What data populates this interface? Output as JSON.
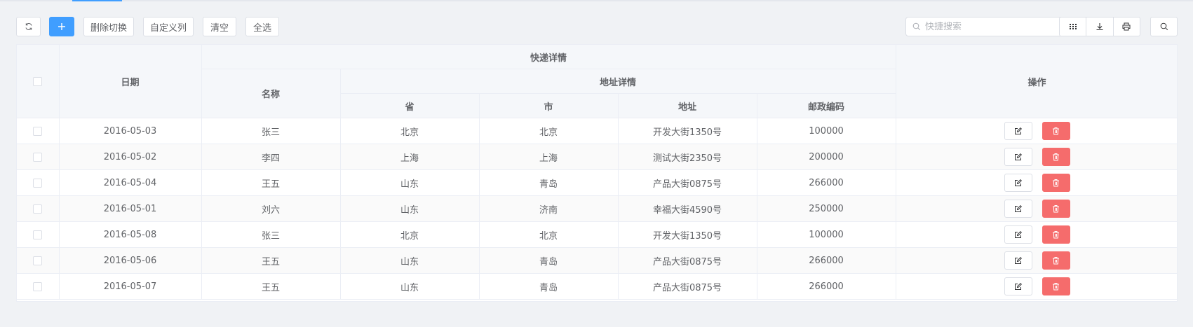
{
  "theme": {
    "accent": "#409eff",
    "danger": "#f56c6c",
    "border": "#dcdfe6"
  },
  "toolbar": {
    "refresh_icon": "refresh-icon",
    "add_icon": "plus-icon",
    "delete_toggle_label": "删除切换",
    "custom_column_label": "自定义列",
    "clear_label": "清空",
    "select_all_label": "全选",
    "search_placeholder": "快捷搜索",
    "columns_icon": "grid-icon",
    "export_icon": "download-icon",
    "print_icon": "printer-icon",
    "search_button_icon": "search-icon"
  },
  "table": {
    "headers": {
      "date": "日期",
      "express_details": "快递详情",
      "name": "名称",
      "address_details": "地址详情",
      "province": "省",
      "city": "市",
      "address": "地址",
      "postcode": "邮政编码",
      "actions": "操作"
    },
    "rows": [
      {
        "date": "2016-05-03",
        "name": "张三",
        "province": "北京",
        "city": "北京",
        "address": "开发大街1350号",
        "postcode": "100000"
      },
      {
        "date": "2016-05-02",
        "name": "李四",
        "province": "上海",
        "city": "上海",
        "address": "测试大街2350号",
        "postcode": "200000"
      },
      {
        "date": "2016-05-04",
        "name": "王五",
        "province": "山东",
        "city": "青岛",
        "address": "产品大街0875号",
        "postcode": "266000"
      },
      {
        "date": "2016-05-01",
        "name": "刘六",
        "province": "山东",
        "city": "济南",
        "address": "幸福大街4590号",
        "postcode": "250000"
      },
      {
        "date": "2016-05-08",
        "name": "张三",
        "province": "北京",
        "city": "北京",
        "address": "开发大街1350号",
        "postcode": "100000"
      },
      {
        "date": "2016-05-06",
        "name": "王五",
        "province": "山东",
        "city": "青岛",
        "address": "产品大街0875号",
        "postcode": "266000"
      },
      {
        "date": "2016-05-07",
        "name": "王五",
        "province": "山东",
        "city": "青岛",
        "address": "产品大街0875号",
        "postcode": "266000"
      }
    ],
    "row_edit_icon": "edit-icon",
    "row_delete_icon": "trash-icon"
  }
}
